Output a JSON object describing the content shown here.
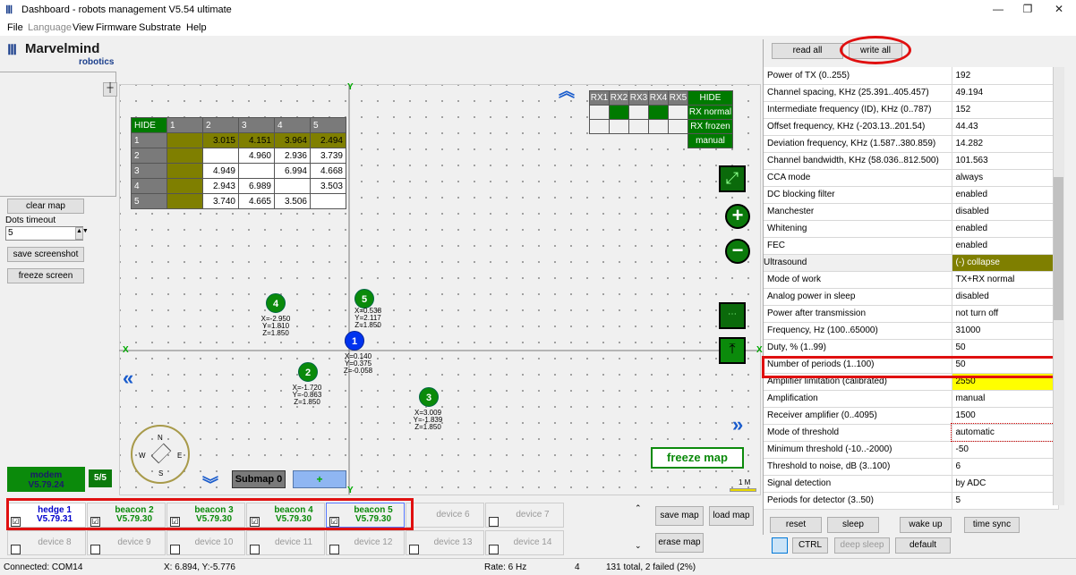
{
  "window": {
    "title": "Dashboard - robots management  V5.54  ultimate",
    "minimize": "—",
    "restore": "❐",
    "close": "✕"
  },
  "menu": [
    "File",
    "Language",
    "View",
    "Firmware",
    "Substrate",
    "Help"
  ],
  "logo": {
    "brand": "Marvelmind",
    "sub": "robotics"
  },
  "left": {
    "clear_map": "clear map",
    "dots_timeout_label": "Dots timeout",
    "dots_timeout_value": "5",
    "save_screenshot": "save screenshot",
    "freeze_screen": "freeze screen",
    "modem": "modem",
    "modem_version": "V5.79.24",
    "count": "5/5"
  },
  "dist_table": {
    "header": [
      "HIDE",
      "1",
      "2",
      "3",
      "4",
      "5"
    ],
    "rows": [
      [
        "1",
        "",
        "3.015",
        "4.151",
        "3.964",
        "2.494"
      ],
      [
        "2",
        "",
        "",
        "4.960",
        "2.936",
        "3.739"
      ],
      [
        "3",
        "",
        "4.949",
        "",
        "6.994",
        "4.668"
      ],
      [
        "4",
        "",
        "2.943",
        "6.989",
        "",
        "3.503"
      ],
      [
        "5",
        "",
        "3.740",
        "4.665",
        "3.506",
        ""
      ]
    ]
  },
  "rx_table": {
    "header": [
      "RX1",
      "RX2",
      "RX3",
      "RX4",
      "RX5",
      "HIDE"
    ],
    "labels": [
      "RX normal",
      "RX frozen",
      "manual"
    ]
  },
  "map": {
    "axis_x": "X",
    "axis_y": "Y",
    "freeze_map": "freeze map",
    "submap": "Submap 0",
    "submap_add": "+",
    "scale": "1 M",
    "nodes": [
      {
        "id": "4",
        "coords": [
          "X=-2.950",
          "Y=1.810",
          "Z=1.850"
        ]
      },
      {
        "id": "5",
        "coords": [
          "X=0.538",
          "Y=2.117",
          "Z=1.850"
        ]
      },
      {
        "id": "1",
        "coords": [
          "X=0.140",
          "Y=0.375",
          "Z=-0.058"
        ]
      },
      {
        "id": "2",
        "coords": [
          "X=-1.720",
          "Y=-0.863",
          "Z=1.850"
        ]
      },
      {
        "id": "3",
        "coords": [
          "X=3.009",
          "Y=-1.839",
          "Z=1.850"
        ]
      }
    ],
    "compass": {
      "n": "N",
      "s": "S",
      "e": "E",
      "w": "W"
    }
  },
  "right": {
    "read_all": "read all",
    "write_all": "write all",
    "props": [
      [
        "Power of TX (0..255)",
        "192"
      ],
      [
        "Channel spacing, KHz (25.391..405.457)",
        "49.194"
      ],
      [
        "Intermediate frequency (ID), KHz (0..787)",
        "152"
      ],
      [
        "Offset frequency, KHz (-203.13..201.54)",
        "44.43"
      ],
      [
        "Deviation frequency, KHz (1.587..380.859)",
        "14.282"
      ],
      [
        "Channel bandwidth, KHz (58.036..812.500)",
        "101.563"
      ],
      [
        "CCA mode",
        "always"
      ],
      [
        "DC blocking filter",
        "enabled"
      ],
      [
        "Manchester",
        "disabled"
      ],
      [
        "Whitening",
        "enabled"
      ],
      [
        "FEC",
        "enabled"
      ],
      [
        "Ultrasound",
        "(-) collapse"
      ],
      [
        "Mode of work",
        "TX+RX normal"
      ],
      [
        "Analog power in sleep",
        "disabled"
      ],
      [
        "Power after transmission",
        "not turn off"
      ],
      [
        "Frequency, Hz (100..65000)",
        "31000"
      ],
      [
        "Duty, % (1..99)",
        "50"
      ],
      [
        "Number of periods (1..100)",
        "50"
      ],
      [
        "Amplifier limitation (calibrated)",
        "2550"
      ],
      [
        "Amplification",
        "manual"
      ],
      [
        "Receiver amplifier (0..4095)",
        "1500"
      ],
      [
        "Mode of threshold",
        "automatic"
      ],
      [
        "Minimum threshold (-10..-2000)",
        "-50"
      ],
      [
        "Threshold to noise, dB (3..100)",
        "6"
      ],
      [
        "Signal detection",
        "by ADC"
      ],
      [
        "Periods for detector (3..50)",
        "5"
      ]
    ],
    "reset": "reset",
    "sleep": "sleep",
    "wake_up": "wake up",
    "time_sync": "time sync",
    "ctrl": "CTRL",
    "deep_sleep": "deep sleep",
    "default": "default"
  },
  "devices": [
    {
      "name": "hedge 1",
      "ver": "V5.79.31",
      "checked": "☑"
    },
    {
      "name": "beacon 2",
      "ver": "V5.79.30",
      "checked": "☑"
    },
    {
      "name": "beacon 3",
      "ver": "V5.79.30",
      "checked": "☑"
    },
    {
      "name": "beacon 4",
      "ver": "V5.79.30",
      "checked": "☑"
    },
    {
      "name": "beacon 5",
      "ver": "V5.79.30",
      "checked": "☑"
    },
    {
      "name": "device 6"
    },
    {
      "name": "device 7"
    },
    {
      "name": "device 8"
    },
    {
      "name": "device 9"
    },
    {
      "name": "device 10"
    },
    {
      "name": "device 11"
    },
    {
      "name": "device 12"
    },
    {
      "name": "device 13"
    },
    {
      "name": "device 14"
    }
  ],
  "map_buttons": {
    "save_map": "save map",
    "load_map": "load map",
    "erase_map": "erase map"
  },
  "status": {
    "connected": "Connected: COM14",
    "cursor": "X: 6.894, Y:-5.776",
    "rate": "Rate: 6 Hz",
    "num": "4",
    "total": "131 total, 2 failed (2%)"
  }
}
